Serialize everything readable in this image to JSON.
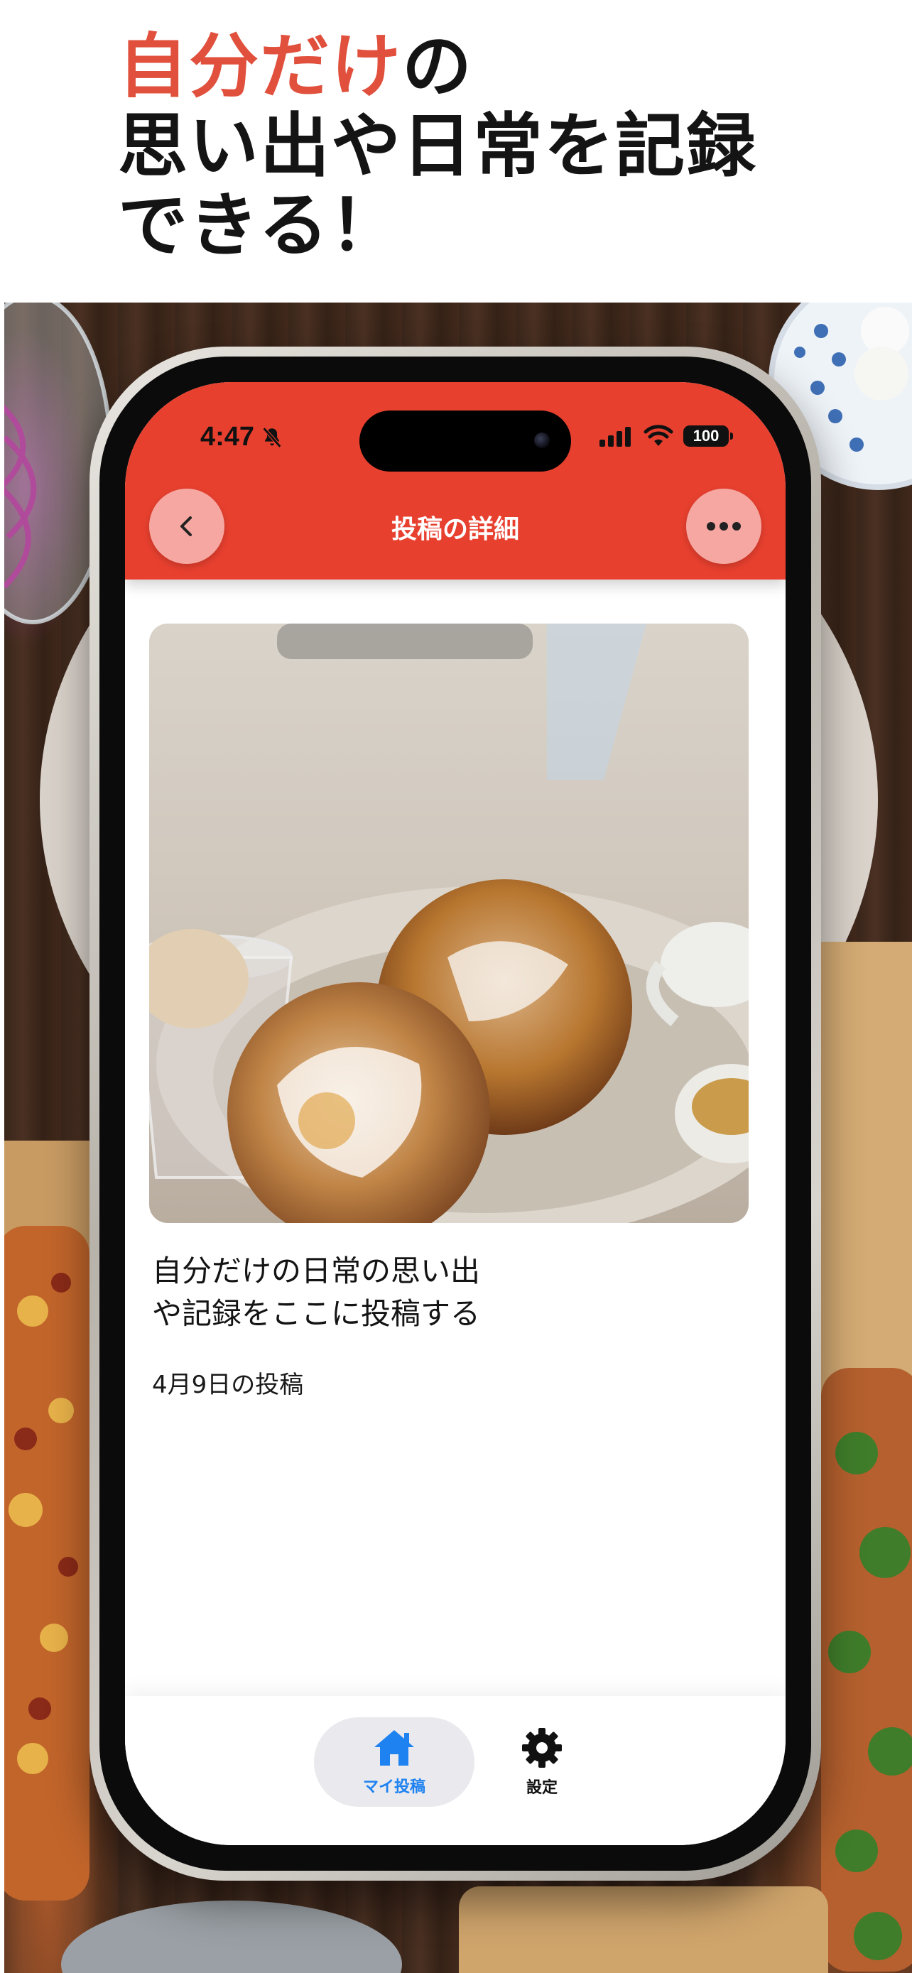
{
  "headline": {
    "accent_text": "自分だけ",
    "line1_rest": "の",
    "line2": "思い出や日常を記録",
    "line3": "できる！"
  },
  "status_bar": {
    "time": "4:47",
    "battery": "100"
  },
  "header": {
    "title": "投稿の詳細",
    "accent_color": "#e8402f"
  },
  "post": {
    "image_description_icon": "french-toast-photo",
    "text_line1": "自分だけの日常の思い出",
    "text_line2": "や記録をここに投稿する",
    "date": "4月9日の投稿"
  },
  "tabs": [
    {
      "label": "マイ投稿",
      "icon": "house-icon",
      "active": true,
      "color": "#1e82f0"
    },
    {
      "label": "設定",
      "icon": "gear-icon",
      "active": false,
      "color": "#111111"
    }
  ]
}
